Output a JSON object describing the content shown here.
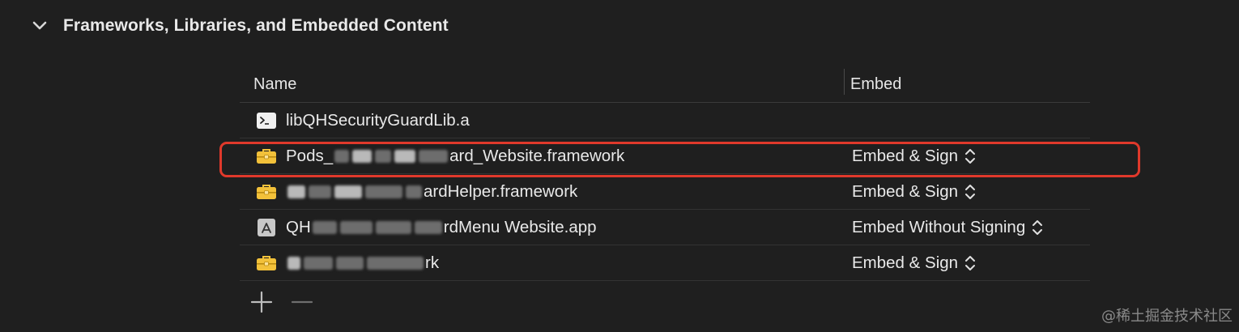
{
  "section": {
    "title": "Frameworks, Libraries, and Embedded Content",
    "chevron_icon": "chevron-down-icon"
  },
  "table": {
    "columns": {
      "name": "Name",
      "embed": "Embed"
    },
    "rows": [
      {
        "icon": "terminal-library-icon",
        "name_before": "libQHSecurityGuardLib.a",
        "name_after": "",
        "embed": ""
      },
      {
        "icon": "toolbox-icon",
        "name_before": "Pods_",
        "name_after": "ard_Website.framework",
        "embed": "Embed & Sign"
      },
      {
        "icon": "toolbox-icon",
        "name_before": "",
        "name_after": "ardHelper.framework",
        "embed": "Embed & Sign"
      },
      {
        "icon": "app-store-icon",
        "name_before": "QH",
        "name_after": "rdMenu Website.app",
        "embed": "Embed Without Signing"
      },
      {
        "icon": "toolbox-icon",
        "name_before": "",
        "name_after": "rk",
        "embed": "Embed & Sign"
      }
    ]
  },
  "footer": {
    "add_icon": "plus-icon",
    "remove_icon": "minus-icon"
  },
  "watermark": "@稀土掘金技术社区",
  "colors": {
    "background": "#1f1f1f",
    "highlight": "#e0392b",
    "toolbox": "#f2c13a"
  }
}
